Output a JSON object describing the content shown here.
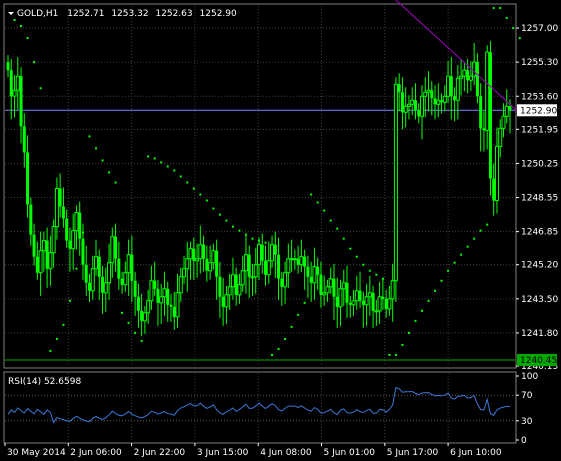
{
  "chart_data": {
    "type": "candlestick",
    "symbol_timeframe": "GOLD,H1",
    "ohlc_readout": [
      "1252.71",
      "1253.32",
      "1252.63",
      "1252.90"
    ],
    "price_axis": {
      "min": 1240.15,
      "max": 1258.1,
      "ticks": [
        "1257.00",
        "1255.30",
        "1253.60",
        "1251.95",
        "1250.25",
        "1248.55",
        "1246.85",
        "1245.20",
        "1243.50",
        "1241.80",
        "1240.15"
      ],
      "current_price": "1252.90",
      "marked_price": "1240.45",
      "current_line_color": "#8080ff",
      "marked_line_color": "#00aa00"
    },
    "time_axis": [
      "30 May 2014",
      "2 Jun 06:00",
      "2 Jun 22:00",
      "3 Jun 15:00",
      "4 Jun 08:00",
      "5 Jun 01:00",
      "5 Jun 17:00",
      "6 Jun 10:00"
    ],
    "candle_color": "#00ff00",
    "sar_color": "#00ff00",
    "trendline_color": "#a000c0",
    "grid": true,
    "close_series": [
      1254.9,
      1253.6,
      1253.9,
      1254.6,
      1252.1,
      1250.8,
      1248.2,
      1246.7,
      1245.6,
      1244.8,
      1245.9,
      1246.4,
      1245.0,
      1245.8,
      1247.1,
      1249.0,
      1248.1,
      1247.5,
      1246.4,
      1246.0,
      1246.9,
      1247.8,
      1246.5,
      1245.2,
      1244.3,
      1243.9,
      1245.0,
      1245.6,
      1244.6,
      1243.8,
      1244.3,
      1245.3,
      1246.6,
      1245.5,
      1244.5,
      1244.2,
      1244.8,
      1245.7,
      1244.4,
      1243.6,
      1242.9,
      1242.4,
      1242.8,
      1243.4,
      1244.4,
      1244.0,
      1243.3,
      1243.6,
      1244.0,
      1243.2,
      1243.1,
      1242.6,
      1243.8,
      1244.6,
      1245.0,
      1245.5,
      1246.0,
      1245.4,
      1245.5,
      1246.2,
      1245.5,
      1244.9,
      1245.3,
      1245.9,
      1244.6,
      1243.6,
      1243.1,
      1243.7,
      1244.1,
      1244.7,
      1243.7,
      1244.2,
      1244.9,
      1245.7,
      1244.6,
      1244.6,
      1245.2,
      1246.2,
      1245.4,
      1244.7,
      1245.4,
      1246.2,
      1245.7,
      1244.5,
      1244.1,
      1244.8,
      1245.5,
      1245.5,
      1245.5,
      1245.2,
      1245.6,
      1245.1,
      1244.6,
      1244.3,
      1245.1,
      1244.7,
      1243.7,
      1243.8,
      1244.1,
      1244.5,
      1243.6,
      1243.1,
      1244.0,
      1244.3,
      1243.3,
      1243.2,
      1243.4,
      1243.9,
      1243.4,
      1243.2,
      1243.6,
      1243.8,
      1242.9,
      1242.9,
      1243.6,
      1243.5,
      1243.0,
      1243.5,
      1244.4,
      1254.2,
      1253.8,
      1252.8,
      1253.1,
      1253.2,
      1253.4,
      1252.9,
      1252.6,
      1253.6,
      1253.8,
      1253.9,
      1253.5,
      1253.2,
      1253.4,
      1253.3,
      1253.6,
      1254.6,
      1253.6,
      1253.4,
      1254.5,
      1254.6,
      1254.9,
      1254.4,
      1254.6,
      1255.3,
      1253.6,
      1252.0,
      1251.9,
      1255.8,
      1249.5,
      1248.4,
      1251.1,
      1252.0,
      1252.6,
      1253.1,
      1252.9
    ],
    "sar_dots": [
      {
        "i": 2,
        "v": 1257.4
      },
      {
        "i": 4,
        "v": 1257.1
      },
      {
        "i": 6,
        "v": 1256.5
      },
      {
        "i": 8,
        "v": 1255.3
      },
      {
        "i": 10,
        "v": 1254.0
      },
      {
        "i": 13,
        "v": 1240.9
      },
      {
        "i": 15,
        "v": 1241.5
      },
      {
        "i": 17,
        "v": 1242.2
      },
      {
        "i": 19,
        "v": 1243.4
      },
      {
        "i": 21,
        "v": 1245.0
      },
      {
        "i": 23,
        "v": 1246.8
      },
      {
        "i": 25,
        "v": 1251.6
      },
      {
        "i": 27,
        "v": 1251.0
      },
      {
        "i": 29,
        "v": 1250.4
      },
      {
        "i": 31,
        "v": 1249.8
      },
      {
        "i": 33,
        "v": 1249.3
      },
      {
        "i": 35,
        "v": 1242.8
      },
      {
        "i": 37,
        "v": 1242.3
      },
      {
        "i": 39,
        "v": 1241.8
      },
      {
        "i": 41,
        "v": 1241.4
      },
      {
        "i": 43,
        "v": 1250.6
      },
      {
        "i": 45,
        "v": 1250.5
      },
      {
        "i": 47,
        "v": 1250.3
      },
      {
        "i": 49,
        "v": 1250.1
      },
      {
        "i": 51,
        "v": 1249.9
      },
      {
        "i": 53,
        "v": 1249.6
      },
      {
        "i": 55,
        "v": 1249.3
      },
      {
        "i": 57,
        "v": 1249.0
      },
      {
        "i": 59,
        "v": 1248.7
      },
      {
        "i": 61,
        "v": 1248.4
      },
      {
        "i": 63,
        "v": 1248.0
      },
      {
        "i": 65,
        "v": 1247.7
      },
      {
        "i": 67,
        "v": 1247.4
      },
      {
        "i": 69,
        "v": 1247.1
      },
      {
        "i": 71,
        "v": 1246.9
      },
      {
        "i": 73,
        "v": 1246.7
      },
      {
        "i": 75,
        "v": 1246.5
      },
      {
        "i": 77,
        "v": 1246.4
      },
      {
        "i": 79,
        "v": 1246.3
      },
      {
        "i": 81,
        "v": 1240.7
      },
      {
        "i": 83,
        "v": 1241.0
      },
      {
        "i": 85,
        "v": 1241.5
      },
      {
        "i": 87,
        "v": 1242.1
      },
      {
        "i": 89,
        "v": 1242.7
      },
      {
        "i": 91,
        "v": 1243.3
      },
      {
        "i": 93,
        "v": 1248.7
      },
      {
        "i": 95,
        "v": 1248.3
      },
      {
        "i": 97,
        "v": 1247.9
      },
      {
        "i": 99,
        "v": 1247.4
      },
      {
        "i": 101,
        "v": 1247.0
      },
      {
        "i": 103,
        "v": 1246.5
      },
      {
        "i": 105,
        "v": 1246.0
      },
      {
        "i": 107,
        "v": 1245.6
      },
      {
        "i": 109,
        "v": 1245.2
      },
      {
        "i": 111,
        "v": 1244.9
      },
      {
        "i": 113,
        "v": 1244.7
      },
      {
        "i": 115,
        "v": 1244.5
      },
      {
        "i": 117,
        "v": 1240.7
      },
      {
        "i": 119,
        "v": 1240.7
      },
      {
        "i": 121,
        "v": 1241.2
      },
      {
        "i": 123,
        "v": 1241.8
      },
      {
        "i": 125,
        "v": 1242.4
      },
      {
        "i": 127,
        "v": 1242.9
      },
      {
        "i": 129,
        "v": 1243.4
      },
      {
        "i": 131,
        "v": 1243.9
      },
      {
        "i": 133,
        "v": 1244.4
      },
      {
        "i": 135,
        "v": 1244.9
      },
      {
        "i": 137,
        "v": 1245.3
      },
      {
        "i": 139,
        "v": 1245.7
      },
      {
        "i": 141,
        "v": 1246.1
      },
      {
        "i": 143,
        "v": 1246.5
      },
      {
        "i": 145,
        "v": 1246.9
      },
      {
        "i": 147,
        "v": 1247.2
      },
      {
        "i": 149,
        "v": 1258.0
      },
      {
        "i": 151,
        "v": 1258.0
      },
      {
        "i": 153,
        "v": 1257.5
      },
      {
        "i": 155,
        "v": 1257.0
      },
      {
        "i": 157,
        "v": 1256.5
      }
    ],
    "trendline": {
      "from": {
        "i": 119,
        "v": 1258.4
      },
      "to": {
        "i": 158,
        "v": 1252.6
      }
    },
    "rsi": {
      "label": "RSI(14) 52.6598",
      "period": 14,
      "last_value": 52.6598,
      "ticks": [
        "100",
        "70",
        "30",
        "0"
      ],
      "range": [
        0,
        100
      ],
      "levels": [
        30,
        70
      ],
      "line_color": "#3c78d8"
    }
  }
}
